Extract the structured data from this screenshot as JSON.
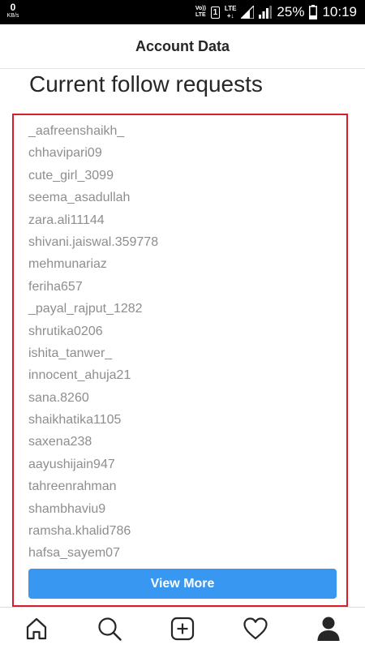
{
  "status_bar": {
    "data_speed": "0",
    "data_unit": "KB/s",
    "volte_top": "Vo))",
    "volte_bottom": "LTE",
    "sim_slot": "1",
    "network_type_top": "LTE",
    "network_type_bottom": "+↓",
    "battery": "25%",
    "time": "10:19"
  },
  "header": {
    "title": "Account Data"
  },
  "section": {
    "title": "Current follow requests"
  },
  "follow_requests": [
    "_aafreenshaikh_",
    "chhavipari09",
    "cute_girl_3099",
    "seema_asadullah",
    "zara.ali11144",
    "shivani.jaiswal.359778",
    "mehmunariaz",
    "feriha657",
    "_payal_rajput_1282",
    "shrutika0206",
    "ishita_tanwer_",
    "innocent_ahuja21",
    "sana.8260",
    "shaikhatika1105",
    "saxena238",
    "aayushijain947",
    "tahreenrahman",
    "shambhaviu9",
    "ramsha.khalid786",
    "hafsa_sayem07"
  ],
  "view_more_label": "View More",
  "bottom_nav": [
    {
      "icon": "home-icon"
    },
    {
      "icon": "search-icon"
    },
    {
      "icon": "add-post-icon"
    },
    {
      "icon": "heart-icon"
    },
    {
      "icon": "profile-icon"
    }
  ],
  "colors": {
    "accent_button": "#3897f0",
    "highlight_border": "#d81e2a",
    "list_text": "#8e8e8e"
  }
}
